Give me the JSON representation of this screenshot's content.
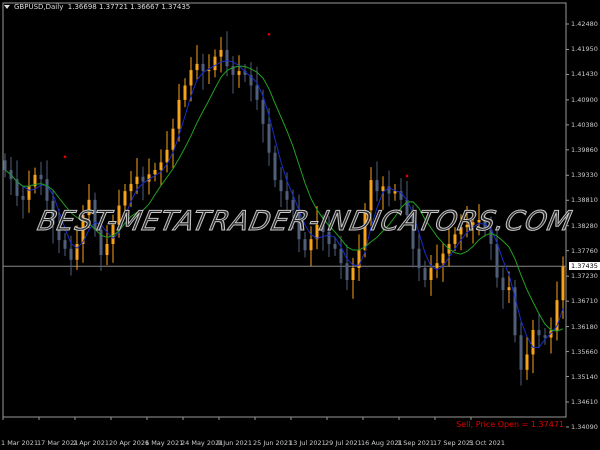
{
  "header": {
    "symbol": "GBPUSD,Daily",
    "ohlc": "1.36698 1.37721 1.36667 1.37435"
  },
  "watermark": "BEST-METATRADER-INDICATORS.COM",
  "signal_label": "Sell, Price Open = 1.37471",
  "colors": {
    "bull": "#f7a21b",
    "bear": "#4f5f7a",
    "ma_slow": "#22a020",
    "ma_fast": "#1a2fc8",
    "signal": "#e00000",
    "grid": "#888888"
  },
  "chart_data": {
    "type": "candlestick",
    "ylim": [
      1.3385,
      1.4305
    ],
    "y_ticks": [
      "1.42480",
      "1.41950",
      "1.41430",
      "1.40900",
      "1.40380",
      "1.39860",
      "1.39330",
      "1.38810",
      "1.38280",
      "1.37760",
      "1.37230",
      "1.36710",
      "1.36180",
      "1.35660",
      "1.35140",
      "1.34610",
      "1.34090"
    ],
    "x_ticks": [
      "1 Mar 2021",
      "17 Mar 2021",
      "2 Apr 2021",
      "20 Apr 2021",
      "6 May 2021",
      "24 May 2021",
      "9 Jun 2021",
      "25 Jun 2021",
      "13 Jul 2021",
      "29 Jul 2021",
      "16 Aug 2021",
      "1 Sep 2021",
      "17 Sep 2021",
      "5 Oct 2021"
    ],
    "current_price": "1.37435",
    "closes": [
      1.3944,
      1.3925,
      1.389,
      1.3882,
      1.391,
      1.3934,
      1.3925,
      1.388,
      1.383,
      1.3798,
      1.378,
      1.3757,
      1.379,
      1.385,
      1.3882,
      1.382,
      1.3767,
      1.379,
      1.383,
      1.387,
      1.39,
      1.3915,
      1.393,
      1.392,
      1.3935,
      1.3944,
      1.396,
      1.3986,
      1.403,
      1.409,
      1.412,
      1.4152,
      1.4165,
      1.415,
      1.4152,
      1.418,
      1.4194,
      1.416,
      1.4142,
      1.415,
      1.4142,
      1.412,
      1.409,
      1.404,
      1.398,
      1.3923,
      1.39,
      1.3882,
      1.386,
      1.38,
      1.3777,
      1.38,
      1.383,
      1.3815,
      1.379,
      1.378,
      1.375,
      1.3715,
      1.374,
      1.3777,
      1.386,
      1.3923,
      1.39,
      1.391,
      1.3895,
      1.39,
      1.3882,
      1.385,
      1.378,
      1.374,
      1.3715,
      1.374,
      1.375,
      1.377,
      1.379,
      1.381,
      1.3825,
      1.383,
      1.3835,
      1.384,
      1.382,
      1.379,
      1.372,
      1.3694,
      1.37,
      1.36,
      1.3528,
      1.356,
      1.3611,
      1.36,
      1.3595,
      1.361,
      1.3673,
      1.3743
    ],
    "signal_points": [
      1.393,
      1.4185,
      1.389
    ]
  }
}
